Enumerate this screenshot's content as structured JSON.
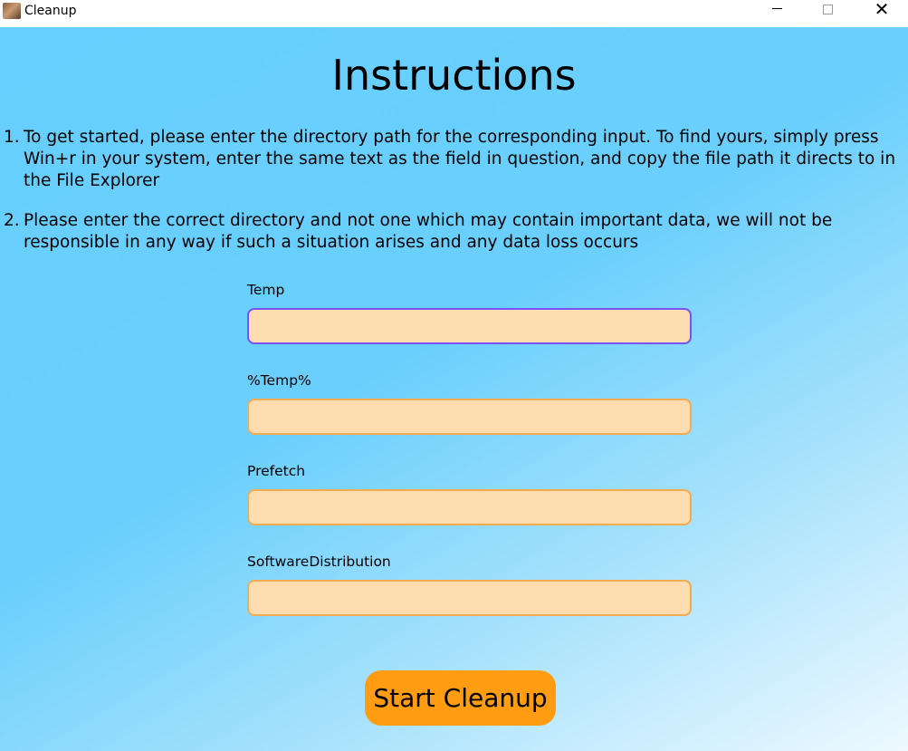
{
  "window": {
    "title": "Cleanup",
    "icon": "app-icon",
    "controls": {
      "minimize_icon": "minimize-icon",
      "maximize_icon": "maximize-icon",
      "close_glyph": "✕"
    }
  },
  "page": {
    "heading": "Instructions",
    "instructions": [
      {
        "number": "1.",
        "text": "To get started, please enter the directory path for the corresponding input. To find yours, simply press Win+r in your system,  enter the same text as the field in question, and copy the file path it directs to in the File Explorer"
      },
      {
        "number": "2.",
        "text": "Please enter the correct directory and not one which may contain important data, we will not be responsible in any way if such a situation arises and any data loss occurs"
      }
    ],
    "fields": [
      {
        "label": "Temp",
        "value": ""
      },
      {
        "label": "%Temp%",
        "value": ""
      },
      {
        "label": "Prefetch",
        "value": ""
      },
      {
        "label": "SoftwareDistribution",
        "value": ""
      }
    ],
    "start_button": "Start Cleanup"
  },
  "colors": {
    "background_start": "#66cfff",
    "background_end": "#eef9ff",
    "input_fill": "#fddcb0",
    "input_border": "#f3ab52",
    "input_focus_border": "#7753f7",
    "button": "#ff9c12"
  }
}
